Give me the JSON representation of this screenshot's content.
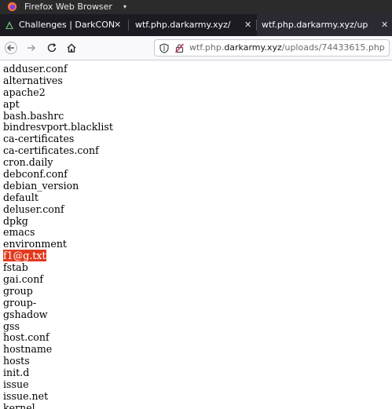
{
  "window": {
    "title": "Firefox Web Browser",
    "caret": "▾"
  },
  "tabs": [
    {
      "label": "Challenges | DarkCON",
      "close": "✕",
      "active": false
    },
    {
      "label": "wtf.php.darkarmy.xyz/",
      "close": "✕",
      "active": false
    },
    {
      "label": "wtf.php.darkarmy.xyz/up",
      "close": "✕",
      "active": true
    }
  ],
  "navbar": {
    "url_prefix": "wtf.php.",
    "url_host": "darkarmy.xyz",
    "url_path": "/uploads/74433615.php"
  },
  "page": {
    "lines": [
      "adduser.conf",
      "alternatives",
      "apache2",
      "apt",
      "bash.bashrc",
      "bindresvport.blacklist",
      "ca-certificates",
      "ca-certificates.conf",
      "cron.daily",
      "debconf.conf",
      "debian_version",
      "default",
      "deluser.conf",
      "dpkg",
      "emacs",
      "environment",
      "f1@g.txt",
      "fstab",
      "gai.conf",
      "group",
      "group-",
      "gshadow",
      "gss",
      "host.conf",
      "hostname",
      "hosts",
      "init.d",
      "issue",
      "issue.net",
      "kernel"
    ],
    "highlighted_line": "f1@g.txt",
    "highlight_color": "#e23a1e"
  }
}
